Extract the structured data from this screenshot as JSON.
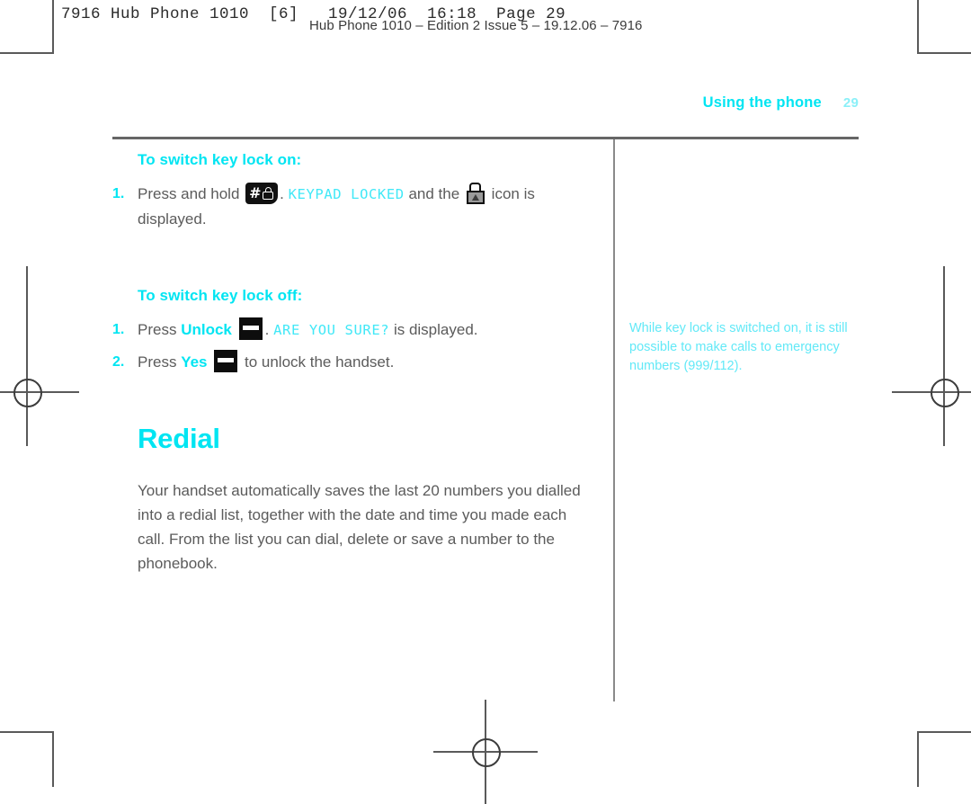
{
  "imposition": {
    "line1": "7916 Hub Phone 1010  [6]   19/12/06  16:18  Page 29",
    "line2": "Hub Phone 1010 – Edition 2 Issue 5 – 19.12.06 – 7916"
  },
  "running_head": {
    "title": "Using the phone",
    "page_number": "29"
  },
  "main": {
    "subhead_on": "To switch key lock on:",
    "subhead_off": "To switch key lock off:",
    "steps_on": [
      {
        "number": "1.",
        "text_before_key": "Press and hold",
        "key_icon": "hash-lock-key-icon",
        "text_after_key": ".",
        "lcd_text": "KEYPAD LOCKED",
        "text_middle": "and the",
        "status_icon": "padlock-icon",
        "text_end": "icon is displayed."
      }
    ],
    "steps_off": [
      {
        "number": "1.",
        "text_before": "Press",
        "keyword": "Unlock",
        "key_icon": "softkey-icon",
        "text_after_key": ".",
        "lcd_text": "ARE YOU SURE?",
        "text_end": "is displayed."
      },
      {
        "number": "2.",
        "text_before": "Press",
        "keyword": "Yes",
        "key_icon": "softkey-icon",
        "text_end": "to unlock the handset."
      }
    ],
    "section_title": "Redial",
    "section_body": "Your handset automatically saves the last 20 numbers you dialled into a redial list, together with the date and time you made each call. From the list you can dial, delete or save a number to the phonebook."
  },
  "side": {
    "note": "While key lock is switched on, it is still possible to make calls to emergency numbers (999/112)."
  },
  "colors": {
    "accent_cyan": "#00e5f2",
    "lcd_cyan": "#41e8f7",
    "body_grey": "#5b5b5b",
    "rule_grey": "#666666",
    "page_number_cyan": "#8bf0f8"
  }
}
